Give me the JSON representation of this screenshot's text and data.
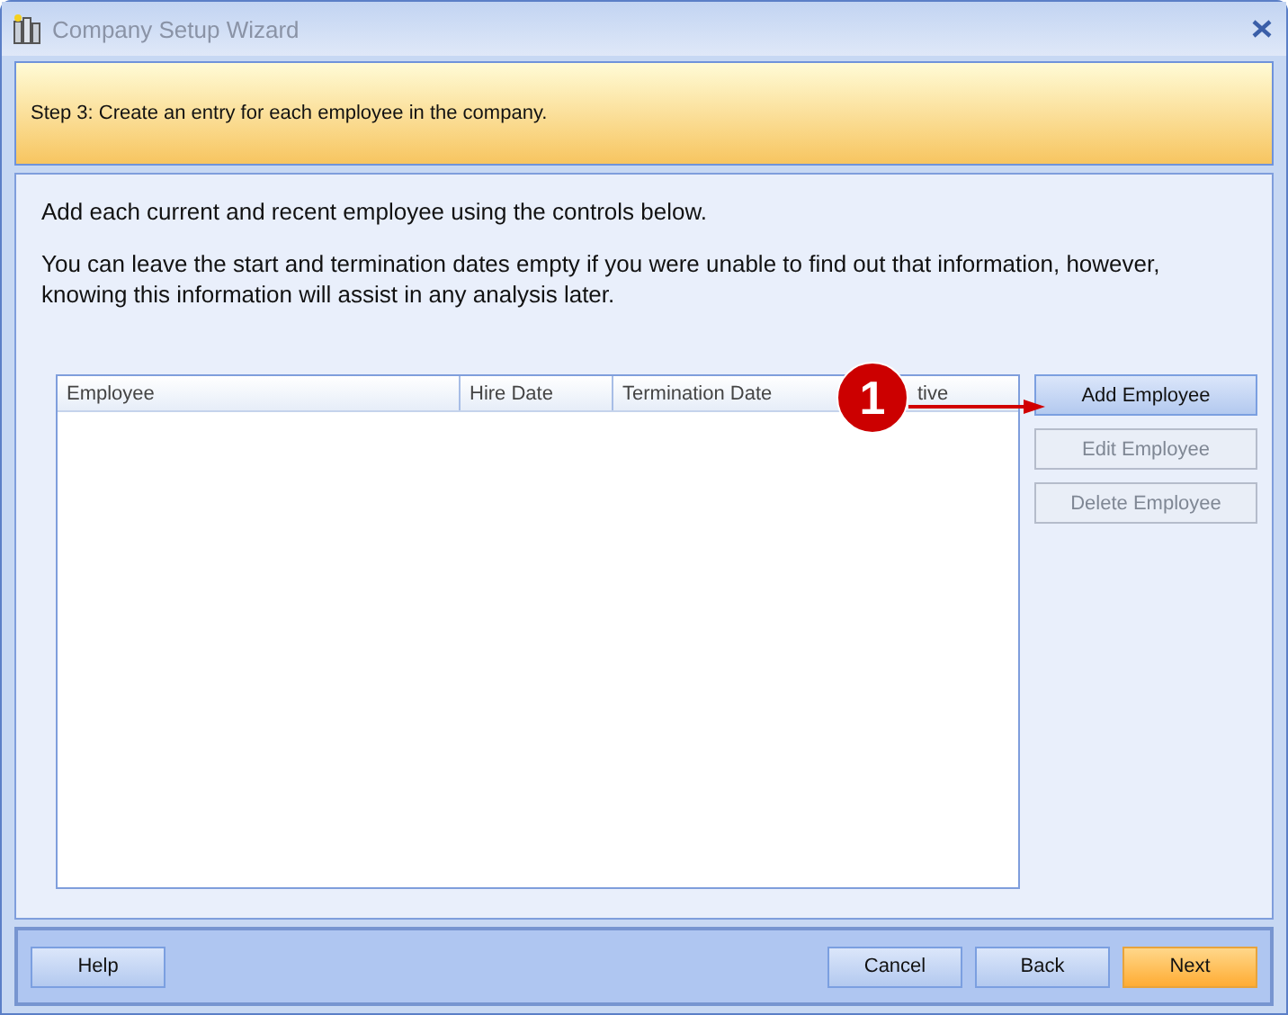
{
  "window": {
    "title": "Company Setup Wizard"
  },
  "banner": {
    "text": "Step 3: Create an entry for each employee in the company."
  },
  "instructions": [
    "Add each current and recent employee using the controls below.",
    "You can leave the start and termination dates empty if you were unable to find out that information, however, knowing this information will assist in any analysis later."
  ],
  "table": {
    "columns": [
      "Employee",
      "Hire Date",
      "Termination Date",
      "tive"
    ]
  },
  "callout": {
    "number": "1"
  },
  "side_buttons": [
    {
      "label": "Add Employee",
      "disabled": false
    },
    {
      "label": "Edit Employee",
      "disabled": true
    },
    {
      "label": "Delete Employee",
      "disabled": true
    }
  ],
  "footer_buttons": [
    {
      "label": "Help",
      "default": false
    },
    {
      "label": "Cancel",
      "default": false
    },
    {
      "label": "Back",
      "default": false
    },
    {
      "label": "Next",
      "default": true
    }
  ]
}
